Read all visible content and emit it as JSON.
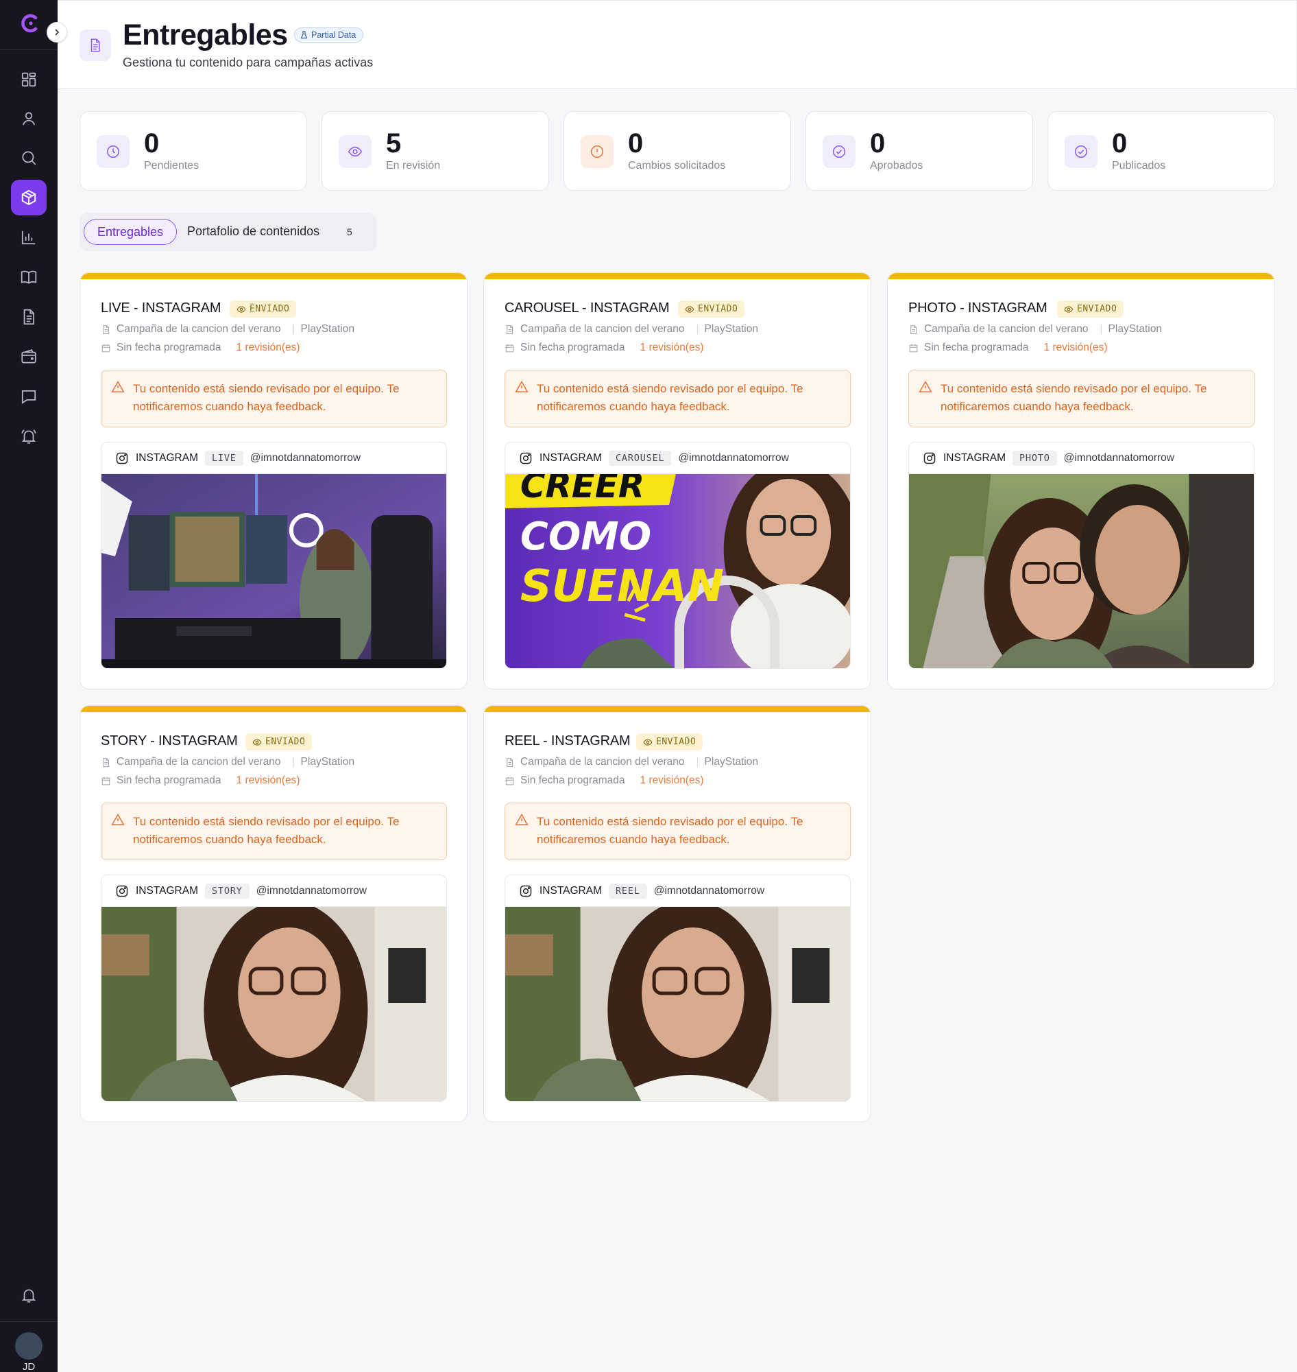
{
  "sidebar": {
    "toggle_icon": "chevron-right-icon",
    "items": [
      {
        "icon": "dashboard-icon",
        "active": false
      },
      {
        "icon": "user-icon",
        "active": false
      },
      {
        "icon": "search-icon",
        "active": false
      },
      {
        "icon": "box-icon",
        "active": true
      },
      {
        "icon": "bar-chart-icon",
        "active": false
      },
      {
        "icon": "book-icon",
        "active": false
      },
      {
        "icon": "document-icon",
        "active": false
      },
      {
        "icon": "wallet-icon",
        "active": false
      },
      {
        "icon": "chat-icon",
        "active": false
      },
      {
        "icon": "bell-ring-icon",
        "active": false
      }
    ],
    "user_initials": "JD"
  },
  "header": {
    "title": "Entregables",
    "badge": "Partial Data",
    "subtitle": "Gestiona tu contenido para campañas activas"
  },
  "stats": [
    {
      "value": "0",
      "label": "Pendientes",
      "icon": "clock-icon",
      "color": "#7c3aed"
    },
    {
      "value": "5",
      "label": "En revisión",
      "icon": "eye-icon",
      "color": "#7c3aed"
    },
    {
      "value": "0",
      "label": "Cambios solicitados",
      "icon": "alert-circle-icon",
      "color": "#ea7a3b"
    },
    {
      "value": "0",
      "label": "Aprobados",
      "icon": "check-circle-icon",
      "color": "#7c3aed"
    },
    {
      "value": "0",
      "label": "Publicados",
      "icon": "check-circle-icon",
      "color": "#7c3aed"
    }
  ],
  "tabs": {
    "active": "Entregables",
    "second": "Portafolio de contenidos",
    "second_count": "5"
  },
  "deliverables": [
    {
      "title": "LIVE - INSTAGRAM",
      "status": "ENVIADO",
      "campaign": "Campaña de la cancion del verano",
      "brand": "PlayStation",
      "date": "Sin fecha programada",
      "revisions": "1 revisión(es)",
      "alert": "Tu contenido está siendo revisado por el equipo. Te notificaremos cuando haya feedback.",
      "platform": "INSTAGRAM",
      "format": "LIVE",
      "handle": "@imnotdannatomorrow",
      "image": "gaming-setup-photo"
    },
    {
      "title": "CAROUSEL - INSTAGRAM",
      "status": "ENVIADO",
      "campaign": "Campaña de la cancion del verano",
      "brand": "PlayStation",
      "date": "Sin fecha programada",
      "revisions": "1 revisión(es)",
      "alert": "Tu contenido está siendo revisado por el equipo. Te notificaremos cuando haya feedback.",
      "platform": "INSTAGRAM",
      "format": "CAROUSEL",
      "handle": "@imnotdannatomorrow",
      "image": "carousel-cover-photo",
      "image_text": [
        "CREER",
        "COMO",
        "SUENAN"
      ]
    },
    {
      "title": "PHOTO - INSTAGRAM",
      "status": "ENVIADO",
      "campaign": "Campaña de la cancion del verano",
      "brand": "PlayStation",
      "date": "Sin fecha programada",
      "revisions": "1 revisión(es)",
      "alert": "Tu contenido está siendo revisado por el equipo. Te notificaremos cuando haya feedback.",
      "platform": "INSTAGRAM",
      "format": "PHOTO",
      "handle": "@imnotdannatomorrow",
      "image": "couple-selfie-photo"
    },
    {
      "title": "STORY - INSTAGRAM",
      "status": "ENVIADO",
      "campaign": "Campaña de la cancion del verano",
      "brand": "PlayStation",
      "date": "Sin fecha programada",
      "revisions": "1 revisión(es)",
      "alert": "Tu contenido está siendo revisado por el equipo. Te notificaremos cuando haya feedback.",
      "platform": "INSTAGRAM",
      "format": "STORY",
      "handle": "@imnotdannatomorrow",
      "image": "selfie-photo"
    },
    {
      "title": "REEL - INSTAGRAM",
      "status": "ENVIADO",
      "campaign": "Campaña de la cancion del verano",
      "brand": "PlayStation",
      "date": "Sin fecha programada",
      "revisions": "1 revisión(es)",
      "alert": "Tu contenido está siendo revisado por el equipo. Te notificaremos cuando haya feedback.",
      "platform": "INSTAGRAM",
      "format": "REEL",
      "handle": "@imnotdannatomorrow",
      "image": "selfie-photo"
    }
  ],
  "colors": {
    "accent": "#7c3aed",
    "card_top": "#f2b705",
    "alert_text": "#d9641f",
    "sidebar_bg": "#171620"
  }
}
